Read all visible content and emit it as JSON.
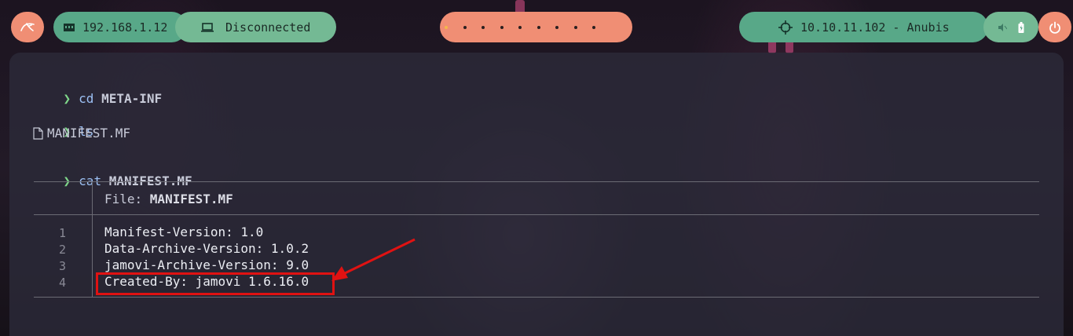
{
  "topbar": {
    "ip_address": "192.168.1.12",
    "network_status": "Disconnected",
    "workspace_count": 9,
    "active_workspace": 1,
    "vpn_target": "10.10.11.102 - Anubis"
  },
  "terminal": {
    "commands": [
      {
        "cmd": "cd",
        "arg": "META-INF"
      },
      {
        "cmd": "ls",
        "arg": ""
      },
      {
        "cmd": "cat",
        "arg": "MANIFEST.MF"
      }
    ],
    "ls_output": "MANIFEST.MF",
    "file_header_label": "File: ",
    "file_header_name": "MANIFEST.MF",
    "lines": [
      {
        "num": "1",
        "text": "Manifest-Version: 1.0"
      },
      {
        "num": "2",
        "text": "Data-Archive-Version: 1.0.2"
      },
      {
        "num": "3",
        "text": "jamovi-Archive-Version: 9.0"
      },
      {
        "num": "4",
        "text": "Created-By: jamovi 1.6.16.0"
      }
    ]
  },
  "colors": {
    "prompt": "#7fd88a",
    "command": "#9cc0f4",
    "annotation": "#e01212",
    "pill_green": "#58a888",
    "pill_orange": "#f08e74"
  }
}
